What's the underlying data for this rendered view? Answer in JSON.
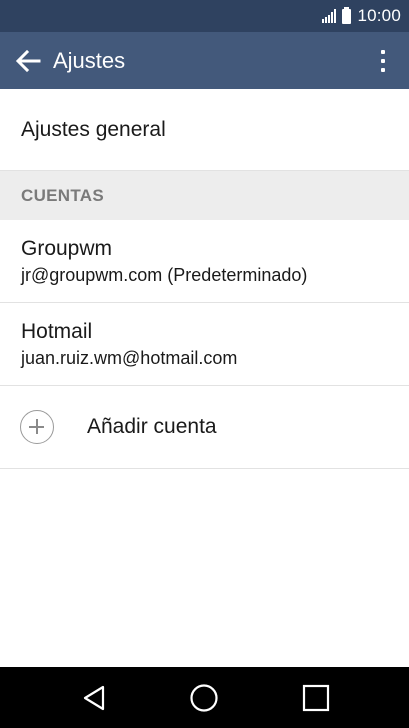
{
  "status_bar": {
    "time": "10:00",
    "icons": [
      "signal-icon",
      "battery-icon"
    ]
  },
  "app_bar": {
    "title": "Ajustes",
    "back_icon": "arrow-left-icon",
    "menu_icon": "more-vertical-icon"
  },
  "general": {
    "label": "Ajustes general"
  },
  "accounts_section": {
    "header": "CUENTAS",
    "accounts": [
      {
        "name": "Groupwm",
        "email": "jr@groupwm.com (Predeterminado)"
      },
      {
        "name": "Hotmail",
        "email": "juan.ruiz.wm@hotmail.com"
      }
    ],
    "add_label": "Añadir cuenta",
    "add_icon": "plus-circle-icon"
  },
  "nav_bar": {
    "buttons": [
      "back-triangle-icon",
      "home-circle-icon",
      "recents-square-icon"
    ]
  },
  "colors": {
    "status_bar": "#2f4260",
    "app_bar": "#43597b",
    "section_bg": "#ededed",
    "section_text": "#7a7a7a"
  }
}
